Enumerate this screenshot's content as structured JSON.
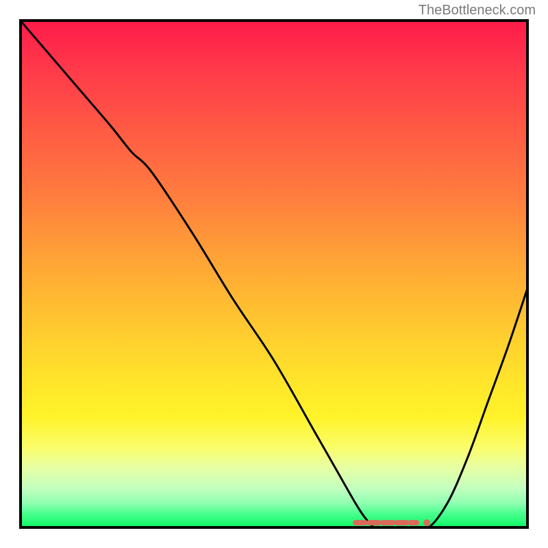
{
  "watermark": "TheBottleneck.com",
  "chart_data": {
    "type": "line",
    "title": "",
    "xlabel": "",
    "ylabel": "",
    "xlim": [
      0,
      100
    ],
    "ylim": [
      0,
      100
    ],
    "grid": false,
    "legend": false,
    "series": [
      {
        "name": "bottleneck-curve",
        "color": "#000000",
        "x": [
          0,
          6,
          12,
          18,
          22,
          26,
          34,
          42,
          50,
          58,
          62,
          66,
          68,
          70,
          72,
          76,
          80,
          84,
          88,
          92,
          96,
          100
        ],
        "y": [
          100,
          93,
          86,
          79,
          74,
          70,
          58,
          45,
          33,
          19,
          12,
          5,
          2,
          0,
          0,
          0,
          0,
          5,
          14,
          25,
          36,
          48
        ]
      }
    ],
    "marker": {
      "name": "optimal-range",
      "color": "#d96a5a",
      "shape": "dashed-segment",
      "x_start": 66,
      "x_end": 78,
      "y": 1.2,
      "dot_x": 80,
      "dot_y": 1.2
    },
    "background_gradient": {
      "top": "#ff1a4a",
      "bottom": "#0bee5d"
    }
  }
}
